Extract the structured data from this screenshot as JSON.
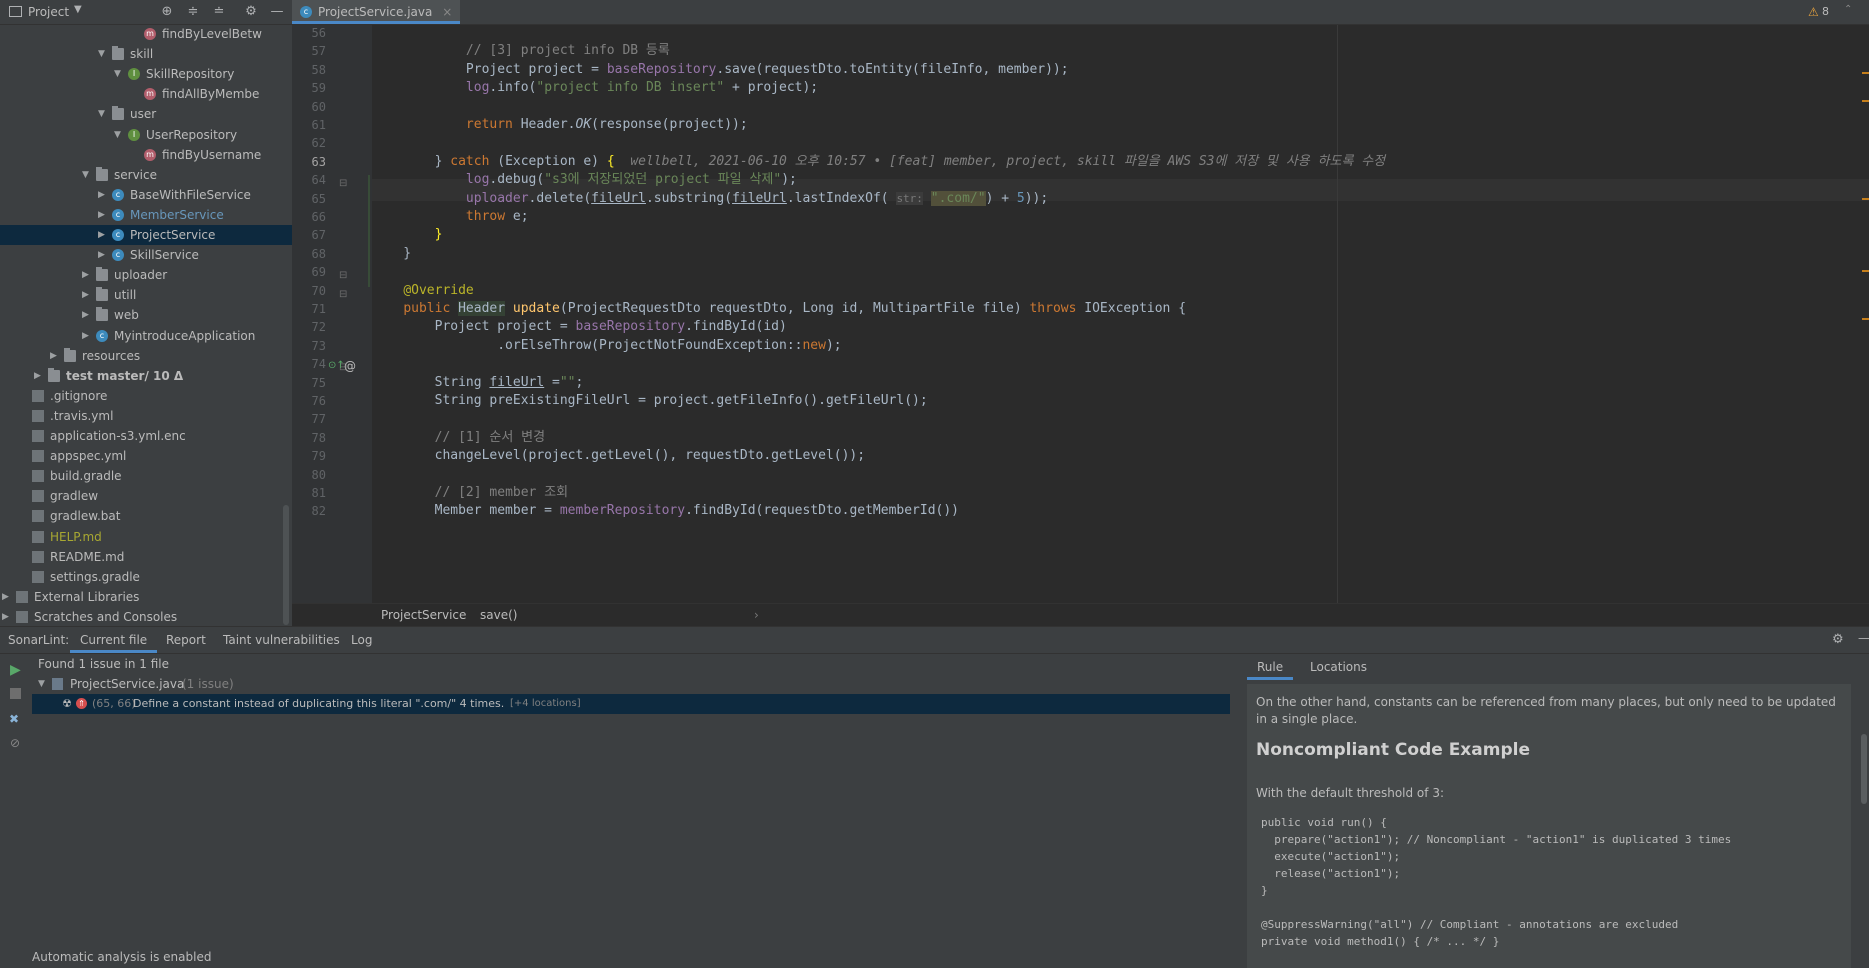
{
  "project_panel": {
    "title": "Project",
    "tree": [
      {
        "label": "findByLevelBetw",
        "kind": "meth",
        "depth": 7,
        "arrow": ""
      },
      {
        "label": "skill",
        "kind": "folder",
        "depth": 5,
        "arrow": "v"
      },
      {
        "label": "SkillRepository",
        "kind": "iface",
        "depth": 6,
        "arrow": "v"
      },
      {
        "label": "findAllByMembe",
        "kind": "meth",
        "depth": 7,
        "arrow": ""
      },
      {
        "label": "user",
        "kind": "folder",
        "depth": 5,
        "arrow": "v"
      },
      {
        "label": "UserRepository",
        "kind": "iface",
        "depth": 6,
        "arrow": "v"
      },
      {
        "label": "findByUsername",
        "kind": "meth",
        "depth": 7,
        "arrow": ""
      },
      {
        "label": "service",
        "kind": "folder",
        "depth": 4,
        "arrow": "v"
      },
      {
        "label": "BaseWithFileService",
        "kind": "cls",
        "depth": 5,
        "arrow": ">"
      },
      {
        "label": "MemberService",
        "kind": "cls",
        "depth": 5,
        "arrow": ">",
        "color": "#6897bb"
      },
      {
        "label": "ProjectService",
        "kind": "cls",
        "depth": 5,
        "arrow": ">",
        "selected": true
      },
      {
        "label": "SkillService",
        "kind": "cls",
        "depth": 5,
        "arrow": ">"
      },
      {
        "label": "uploader",
        "kind": "folder",
        "depth": 4,
        "arrow": ">"
      },
      {
        "label": "utill",
        "kind": "folder",
        "depth": 4,
        "arrow": ">"
      },
      {
        "label": "web",
        "kind": "folder",
        "depth": 4,
        "arrow": ">"
      },
      {
        "label": "MyintroduceApplication",
        "kind": "cls",
        "depth": 4,
        "arrow": ">"
      },
      {
        "label": "resources",
        "kind": "folder",
        "depth": 2,
        "arrow": ">"
      },
      {
        "label": "test  master/ 10 Δ",
        "kind": "folder",
        "depth": 1,
        "arrow": ">",
        "bold": true
      },
      {
        "label": ".gitignore",
        "kind": "file",
        "depth": 0,
        "arrow": ""
      },
      {
        "label": ".travis.yml",
        "kind": "file",
        "depth": 0,
        "arrow": ""
      },
      {
        "label": "application-s3.yml.enc",
        "kind": "file",
        "depth": 0,
        "arrow": ""
      },
      {
        "label": "appspec.yml",
        "kind": "file",
        "depth": 0,
        "arrow": ""
      },
      {
        "label": "build.gradle",
        "kind": "file",
        "depth": 0,
        "arrow": ""
      },
      {
        "label": "gradlew",
        "kind": "file",
        "depth": 0,
        "arrow": ""
      },
      {
        "label": "gradlew.bat",
        "kind": "file",
        "depth": 0,
        "arrow": ""
      },
      {
        "label": "HELP.md",
        "kind": "file",
        "depth": 0,
        "arrow": "",
        "color": "#a8a832"
      },
      {
        "label": "README.md",
        "kind": "file",
        "depth": 0,
        "arrow": ""
      },
      {
        "label": "settings.gradle",
        "kind": "file",
        "depth": 0,
        "arrow": ""
      },
      {
        "label": "External Libraries",
        "kind": "lib",
        "depth": -1,
        "arrow": ">"
      },
      {
        "label": "Scratches and Consoles",
        "kind": "lib",
        "depth": -1,
        "arrow": ">"
      }
    ]
  },
  "editor": {
    "tab": "ProjectService.java",
    "warnings": "8",
    "lines": [
      {
        "n": "56",
        "html": ""
      },
      {
        "n": "57",
        "html": "            <span class='cmt'>// [3] project info DB 등록</span>"
      },
      {
        "n": "58",
        "html": "            Project project = <span class='fld'>baseRepository</span>.save(requestDto.toEntity(fileInfo, member));"
      },
      {
        "n": "59",
        "html": "            <span class='fld'>log</span>.info(<span class='str'>\"project info DB insert\"</span> + project);"
      },
      {
        "n": "60",
        "html": ""
      },
      {
        "n": "61",
        "html": "            <span class='kw'>return</span> Header.<span class='ital'>OK</span>(response(project));"
      },
      {
        "n": "62",
        "html": ""
      },
      {
        "n": "63",
        "html": "        } <span class='kw'>catch</span> (Exception e) <span style='color:#ffef28'>{</span>  <span class='cmt ital'>wellbell, 2021-06-10 오후 10:57 • [feat] member, project, skill 파일을 AWS S3에 저장 및 사용 하도록 수정</span>"
      },
      {
        "n": "64",
        "html": "            <span class='fld'>log</span>.debug(<span class='str'>\"s3에 저장되었던 project 파일 삭제\"</span>);"
      },
      {
        "n": "65",
        "html": "            <span class='fld'>uploader</span>.delete(<u>fileUrl</u>.substring(<u>fileUrl</u>.lastIndexOf( <span style='color:#787878;background:#3b3b3b;font-size:11px'>str:</span> <span class='str' style='background:#52503a'>\".com/\"</span>) + <span class='num'>5</span>));"
      },
      {
        "n": "66",
        "html": "            <span class='kw'>throw</span> e;"
      },
      {
        "n": "67",
        "html": "        <span style='color:#ffef28'>}</span>"
      },
      {
        "n": "68",
        "html": "    }"
      },
      {
        "n": "69",
        "html": ""
      },
      {
        "n": "70",
        "html": "    <span class='ann'>@Override</span>"
      },
      {
        "n": "71",
        "html": "    <span class='kw'>public</span> <span style='background:#344134'>Header</span> <span class='mth'>update</span>(ProjectRequestDto requestDto, Long id, MultipartFile file) <span class='kw'>throws</span> IOException {"
      },
      {
        "n": "72",
        "html": "        Project project = <span class='fld'>baseRepository</span>.findById(id)"
      },
      {
        "n": "73",
        "html": "                .orElseThrow(ProjectNotFoundException::<span class='kw'>new</span>);"
      },
      {
        "n": "74",
        "html": ""
      },
      {
        "n": "75",
        "html": "        String <u>fileUrl</u> =<span class='str'>\"\"</span>;"
      },
      {
        "n": "76",
        "html": "        String preExistingFileUrl = project.getFileInfo().getFileUrl();"
      },
      {
        "n": "77",
        "html": ""
      },
      {
        "n": "78",
        "html": "        <span class='cmt'>// [1] 순서 변경</span>"
      },
      {
        "n": "79",
        "html": "        changeLevel(project.getLevel(), requestDto.getLevel());"
      },
      {
        "n": "80",
        "html": ""
      },
      {
        "n": "81",
        "html": "        <span class='cmt'>// [2] member 조회</span>"
      },
      {
        "n": "82",
        "html": "        Member member = <span class='fld'>memberRepository</span>.findById(requestDto.getMemberId())"
      }
    ],
    "breadcrumb": [
      "ProjectService",
      "save()"
    ]
  },
  "bottom": {
    "label": "SonarLint:",
    "tabs": [
      "Current file",
      "Report",
      "Taint vulnerabilities",
      "Log"
    ],
    "found": "Found 1 issue in 1 file",
    "file": "ProjectService.java",
    "file_count": "(1 issue)",
    "issue_loc": "(65, 66)",
    "issue_text": "Define a constant instead of duplicating this literal \".com/\" 4 times.",
    "issue_extra": "[+4 locations]",
    "status": "Automatic analysis is enabled",
    "rule_tabs": [
      "Rule",
      "Locations"
    ],
    "rule": {
      "intro": "On the other hand, constants can be referenced from many places, but only need to be updated in a single place.",
      "heading": "Noncompliant Code Example",
      "threshold": "With the default threshold of 3:",
      "code": [
        "public void run() {",
        "  prepare(\"action1\"); // Noncompliant - \"action1\" is duplicated 3 times",
        "  execute(\"action1\");",
        "  release(\"action1\");",
        "}",
        "",
        "@SuppressWarning(\"all\") // Compliant - annotations are excluded",
        "private void method1() { /* ... */ }"
      ]
    }
  }
}
